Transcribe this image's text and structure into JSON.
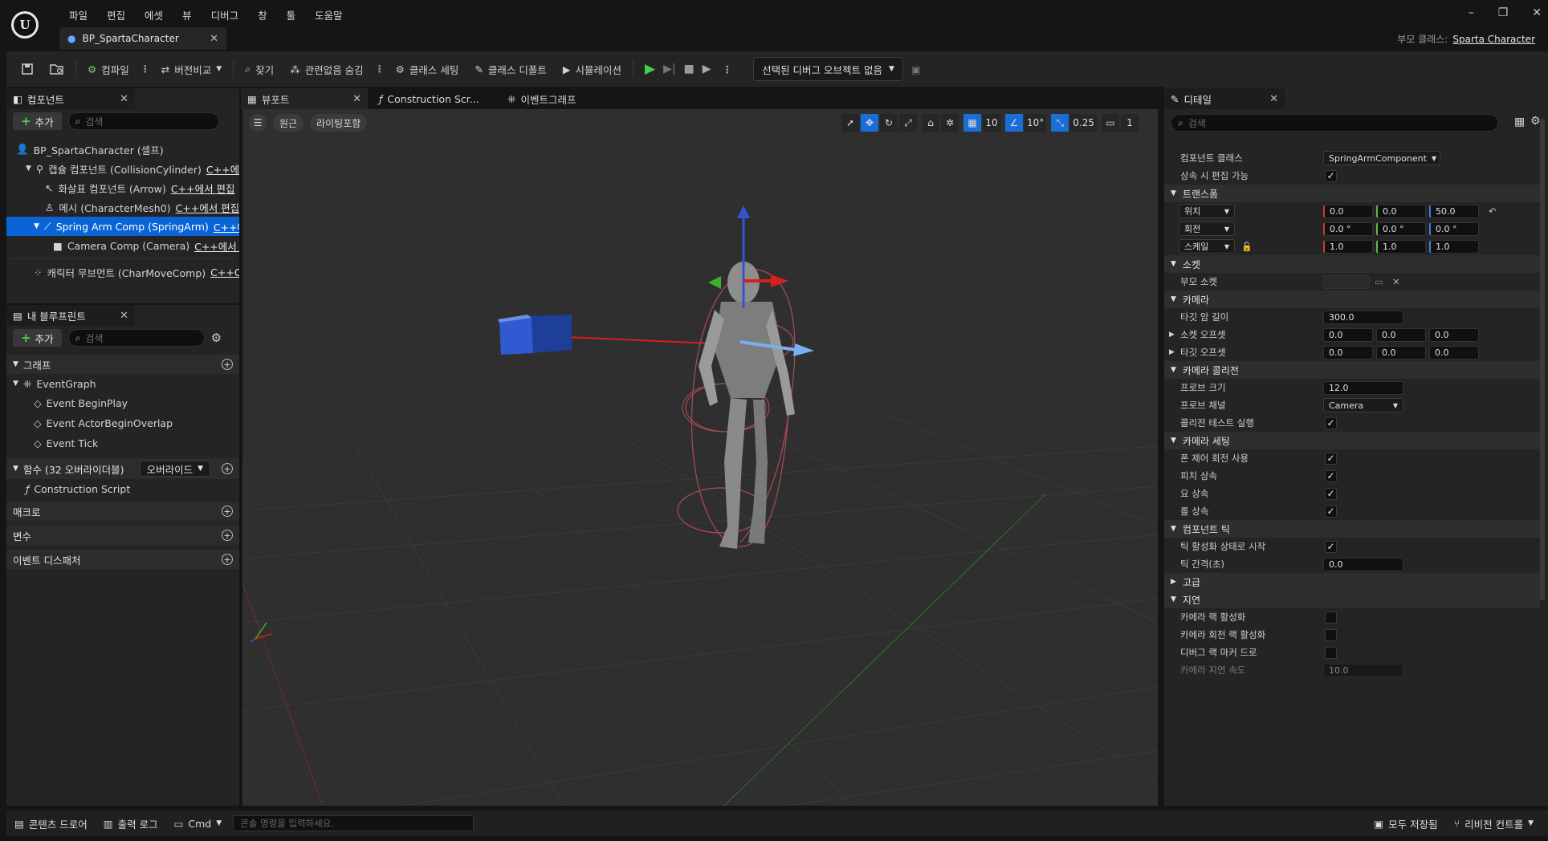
{
  "menu": [
    "파일",
    "편집",
    "에셋",
    "뷰",
    "디버그",
    "창",
    "툴",
    "도움말"
  ],
  "document_tab": "BP_SpartaCharacter",
  "parent_class": {
    "label": "부모 클래스:",
    "value": "Sparta Character"
  },
  "toolbar": {
    "compile": "컴파일",
    "diff": "버전비교",
    "find": "찾기",
    "hide_unrelated": "관련없음 숨김",
    "class_settings": "클래스 세팅",
    "class_defaults": "클래스 디폴트",
    "simulation": "시뮬레이션",
    "debug_object": "선택된 디버그 오브젝트 없음"
  },
  "components_panel": {
    "title": "컴포넌트",
    "add": "추가",
    "search_placeholder": "검색",
    "tree": [
      {
        "label": "BP_SpartaCharacter (셀프)",
        "cpp": "",
        "icon": "person-icon"
      },
      {
        "label": "캡슐 컴포넌트 (CollisionCylinder)",
        "cpp": "C++에",
        "icon": "capsule-icon"
      },
      {
        "label": "화살표 컴포넌트 (Arrow)",
        "cpp": "C++에서 편집",
        "icon": "arrow-icon"
      },
      {
        "label": "메시 (CharacterMesh0)",
        "cpp": "C++에서 편집",
        "icon": "mesh-icon"
      },
      {
        "label": "Spring Arm Comp (SpringArm)",
        "cpp": "C++에",
        "icon": "springarm-icon",
        "selected": true
      },
      {
        "label": "Camera Comp (Camera)",
        "cpp": "C++에서 편",
        "icon": "camera-icon"
      },
      {
        "label": "캐릭터 무브먼트 (CharMoveComp)",
        "cpp": "C++C",
        "icon": "movement-icon"
      }
    ]
  },
  "blueprint_panel": {
    "title": "내 블루프린트",
    "add": "추가",
    "search_placeholder": "검색",
    "graph_section": "그래프",
    "event_graph": "EventGraph",
    "events": [
      "Event BeginPlay",
      "Event ActorBeginOverlap",
      "Event Tick"
    ],
    "functions_section": "함수 (32 오버라이더블)",
    "override_label": "오버라이드",
    "construction_script": "Construction Script",
    "macros": "매크로",
    "variables": "변수",
    "dispatchers": "이벤트 디스패처"
  },
  "viewport_tabs": [
    "뷰포트",
    "Construction Scr...",
    "이벤트그래프"
  ],
  "viewport": {
    "perspective": "원근",
    "lighting": "라이팅포함",
    "grid_snap": "10",
    "rotation_snap": "10°",
    "scale_snap": "0.25",
    "camera_speed": "1"
  },
  "details_panel": {
    "title": "디테일",
    "search_placeholder": "검색",
    "component_class_label": "컴포넌트 클래스",
    "component_class_value": "SpringArmComponent",
    "editable_inherit_label": "상속 시 편집 가능",
    "sections": {
      "transform": "트랜스폼",
      "sockets": "소켓",
      "camera": "카메라",
      "camera_collision": "카메라 콜리전",
      "camera_settings": "카메라 세팅",
      "component_tick": "컴포넌트 틱",
      "advanced": "고급",
      "lag": "지연"
    },
    "transform": {
      "location_label": "위치",
      "location": [
        "0.0",
        "0.0",
        "50.0"
      ],
      "rotation_label": "회전",
      "rotation": [
        "0.0 °",
        "0.0 °",
        "0.0 °"
      ],
      "scale_label": "스케일",
      "scale": [
        "1.0",
        "1.0",
        "1.0"
      ]
    },
    "parent_socket_label": "부모 소켓",
    "target_arm_length_label": "타깃 암 길이",
    "target_arm_length": "300.0",
    "socket_offset_label": "소켓 오프셋",
    "socket_offset": [
      "0.0",
      "0.0",
      "0.0"
    ],
    "target_offset_label": "타깃 오프셋",
    "target_offset": [
      "0.0",
      "0.0",
      "0.0"
    ],
    "probe_size_label": "프로브 크기",
    "probe_size": "12.0",
    "probe_channel_label": "프로브 채널",
    "probe_channel": "Camera",
    "collision_test_label": "콜리전 테스트 실행",
    "use_pawn_control_rotation_label": "폰 제어 회전 사용",
    "inherit_pitch_label": "피치 상속",
    "inherit_yaw_label": "요 상속",
    "inherit_roll_label": "롤 상속",
    "start_tick_enabled_label": "틱 활성화 상태로 시작",
    "tick_interval_label": "틱 간격(초)",
    "tick_interval": "0.0",
    "enable_camera_lag_label": "카메라 랙 활성화",
    "enable_camera_rotation_lag_label": "카메라 회전 랙 활성화",
    "draw_debug_lag_markers_label": "디버그 랙 마커 드로",
    "camera_lag_speed_label": "카메라 지연 속도",
    "camera_lag_speed": "10.0"
  },
  "bottom_bar": {
    "content_drawer": "콘텐츠 드로어",
    "output_log": "출력 로그",
    "cmd": "Cmd",
    "console_placeholder": "콘솔 명령을 입력하세요.",
    "save_all": "모두 저장됨",
    "revision_control": "리비전 컨트롤"
  }
}
